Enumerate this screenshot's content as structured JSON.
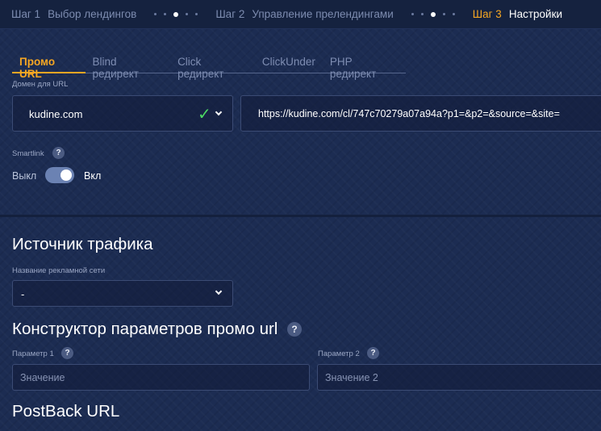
{
  "steps": [
    {
      "number": "Шаг 1",
      "label": "Выбор лендингов"
    },
    {
      "number": "Шаг 2",
      "label": "Управление прелендингами"
    },
    {
      "number": "Шаг 3",
      "label": "Настройки"
    }
  ],
  "tabs": [
    "Промо URL",
    "Blind редирект",
    "Click редирект",
    "ClickUnder",
    "PHP редирект"
  ],
  "domain": {
    "label": "Домен для URL",
    "value": "kudine.com"
  },
  "promo_url": "https://kudine.com/cl/747c70279a07a94a?p1=&p2=&source=&site=",
  "smartlink": {
    "label": "Smartlink",
    "help": "?",
    "off_label": "Выкл",
    "on_label": "Вкл",
    "enabled": true
  },
  "traffic_source": {
    "title": "Источник трафика",
    "network_label": "Название рекламной сети",
    "network_value": "-"
  },
  "constructor": {
    "title": "Конструктор параметров промо url",
    "help": "?",
    "param1": {
      "label": "Параметр 1",
      "help": "?",
      "placeholder": "Значение"
    },
    "param2": {
      "label": "Параметр 2",
      "help": "?",
      "placeholder": "Значение 2"
    }
  },
  "postback": {
    "title": "PostBack URL"
  },
  "colors": {
    "accent": "#f5a623",
    "background": "#1c2c52",
    "success": "#4cd964"
  },
  "icons": {
    "check": "checkmark-icon",
    "chevron": "chevron-down-icon",
    "help": "question-icon"
  }
}
